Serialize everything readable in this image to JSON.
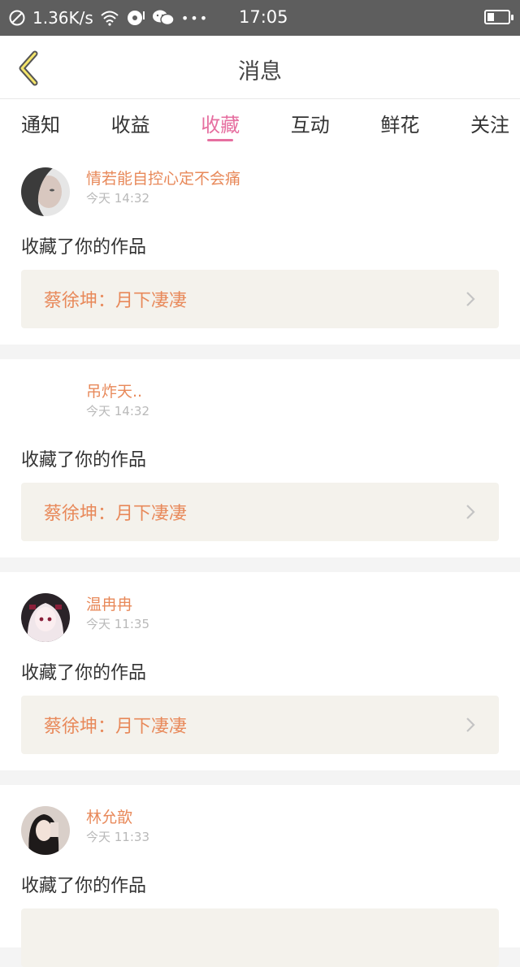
{
  "status_bar": {
    "speed": "1.36K/s",
    "time": "17:05",
    "dots": "•••",
    "battery_level": 0.35
  },
  "nav": {
    "title": "消息"
  },
  "tabs": [
    {
      "label": "通知"
    },
    {
      "label": "收益"
    },
    {
      "label": "收藏"
    },
    {
      "label": "互动"
    },
    {
      "label": "鲜花"
    },
    {
      "label": "关注"
    }
  ],
  "messages": [
    {
      "name": "情若能自控心定不会痛",
      "time": "今天 14:32",
      "action": "收藏了你的作品",
      "work": "蔡徐坤：月下凄凄"
    },
    {
      "name": "吊炸天..",
      "time": "今天 14:32",
      "action": "收藏了你的作品",
      "work": "蔡徐坤：月下凄凄"
    },
    {
      "name": "温冉冉",
      "time": "今天 11:35",
      "action": "收藏了你的作品",
      "work": "蔡徐坤：月下凄凄"
    },
    {
      "name": "林允歆",
      "time": "今天 11:33",
      "action": "收藏了你的作品",
      "work": ""
    }
  ],
  "colors": {
    "accent": "#e66fa0",
    "orange": "#e8895a",
    "status_bar": "#5e5e5e"
  }
}
